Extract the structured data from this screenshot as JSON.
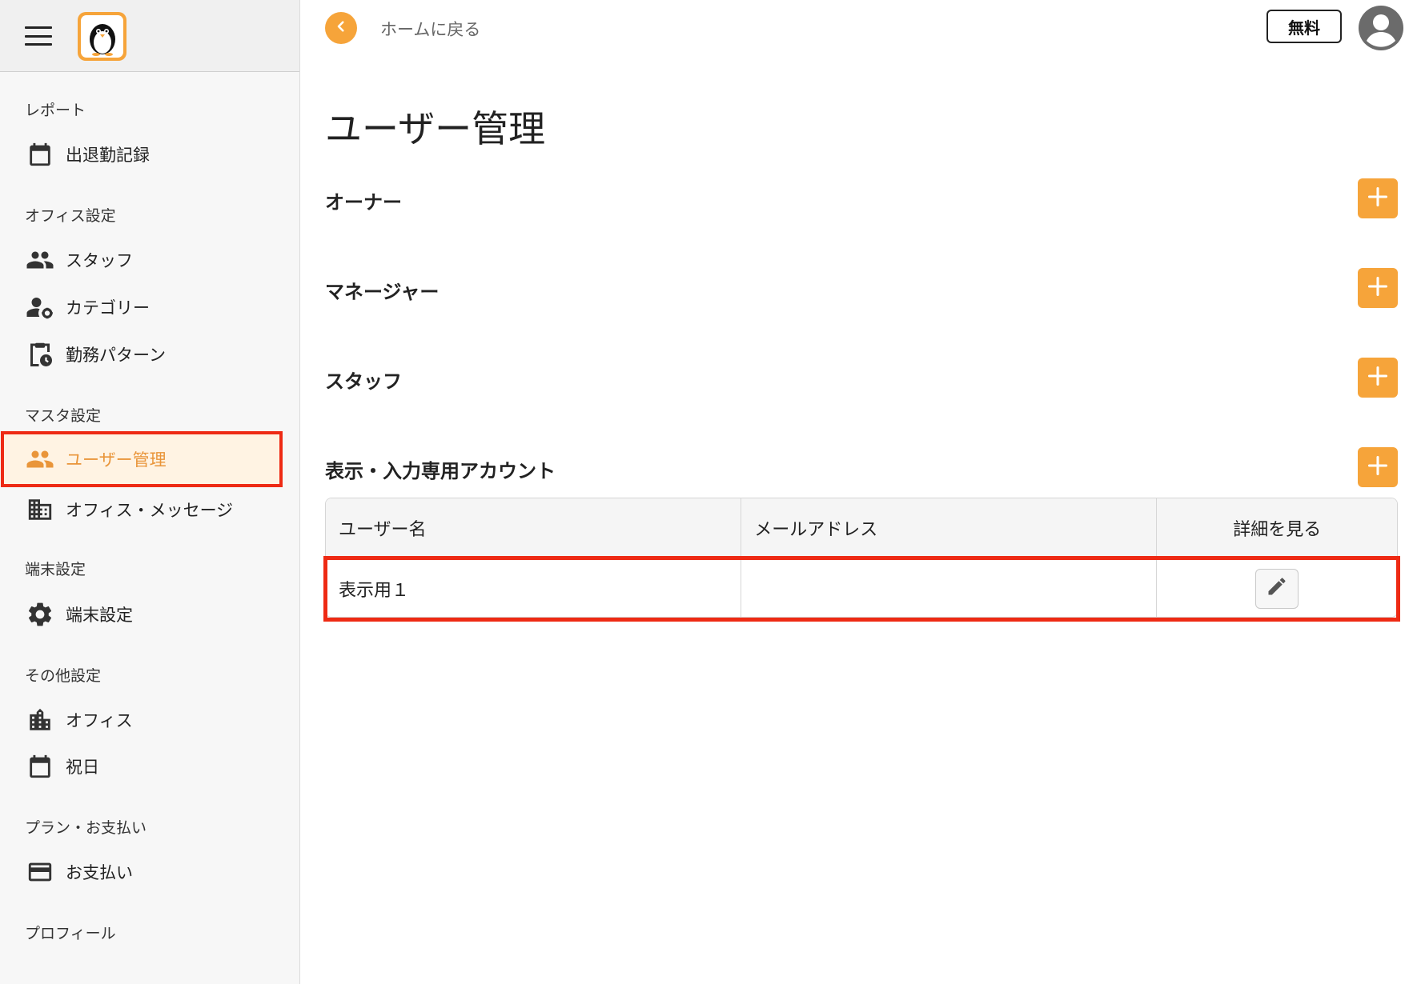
{
  "sidebar": {
    "menu_icon": "hamburger-menu-icon",
    "logo_icon": "penguin-logo-icon",
    "sections": {
      "report": "レポート",
      "office_settings": "オフィス設定",
      "master_settings": "マスタ設定",
      "device_settings": "端末設定",
      "other_settings": "その他設定",
      "plan": "プラン・お支払い",
      "profile": "プロフィール"
    },
    "items": {
      "attendance": "出退勤記録",
      "staff": "スタッフ",
      "category": "カテゴリー",
      "work_pattern": "勤務パターン",
      "user_management": "ユーザー管理",
      "office_message": "オフィス・メッセージ",
      "device_settings": "端末設定",
      "office": "オフィス",
      "holiday": "祝日",
      "payment": "お支払い"
    }
  },
  "topbar": {
    "back_label": "ホームに戻る",
    "plan_badge": "無料"
  },
  "main": {
    "title": "ユーザー管理",
    "roles": {
      "owner": "オーナー",
      "manager": "マネージャー",
      "staff": "スタッフ",
      "display_account": "表示・入力専用アカウント"
    },
    "table": {
      "headers": [
        "ユーザー名",
        "メールアドレス",
        "詳細を見る"
      ],
      "rows": [
        {
          "name": "表示用１",
          "email": ""
        }
      ]
    }
  },
  "colors": {
    "accent": "#f6a43a",
    "highlight": "#ee2a14",
    "active_bg": "#fff3e3",
    "active_text": "#e9953a"
  }
}
